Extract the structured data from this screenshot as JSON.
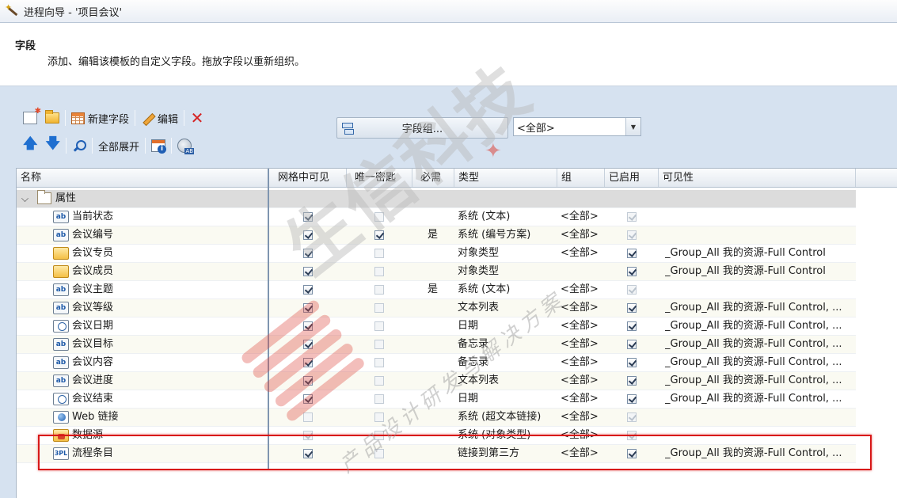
{
  "window": {
    "title": "进程向导 - '项目会议'"
  },
  "header": {
    "heading": "字段",
    "description": "添加、编辑该模板的自定义字段。拖放字段以重新组织。"
  },
  "toolbar": {
    "new_field_label": "新建字段",
    "edit_label": "编辑",
    "expand_all_label": "全部展开",
    "field_group_label": "字段组...",
    "group_filter_value": "<全部>"
  },
  "columns": {
    "name": "名称",
    "visible_in_grid": "网格中可见",
    "unique_key": "唯一密匙",
    "required": "必需",
    "type": "类型",
    "group": "组",
    "enabled": "已启用",
    "visibility": "可见性"
  },
  "group_row": {
    "label": "属性"
  },
  "rows": [
    {
      "icon": "text-field-icon",
      "name": "当前状态",
      "visible": true,
      "visible_disabled": false,
      "unique": false,
      "unique_disabled": true,
      "required": "",
      "type": "系统 (文本)",
      "group": "<全部>",
      "enabled": true,
      "enabled_disabled": true,
      "visibility": ""
    },
    {
      "icon": "text-field-icon",
      "name": "会议编号",
      "visible": true,
      "visible_disabled": false,
      "unique": true,
      "unique_disabled": false,
      "required": "是",
      "type": "系统 (编号方案)",
      "group": "<全部>",
      "enabled": true,
      "enabled_disabled": true,
      "visibility": ""
    },
    {
      "icon": "folder-field-icon",
      "name": "会议专员",
      "visible": true,
      "visible_disabled": false,
      "unique": false,
      "unique_disabled": true,
      "required": "",
      "type": "对象类型",
      "group": "<全部>",
      "enabled": true,
      "enabled_disabled": false,
      "visibility": "_Group_All 我的资源-Full Control"
    },
    {
      "icon": "folder-field-icon",
      "name": "会议成员",
      "visible": true,
      "visible_disabled": false,
      "unique": false,
      "unique_disabled": true,
      "required": "",
      "type": "对象类型",
      "group": "",
      "enabled": true,
      "enabled_disabled": false,
      "visibility": "_Group_All 我的资源-Full Control"
    },
    {
      "icon": "text-field-icon",
      "name": "会议主题",
      "visible": true,
      "visible_disabled": false,
      "unique": false,
      "unique_disabled": true,
      "required": "是",
      "type": "系统 (文本)",
      "group": "<全部>",
      "enabled": true,
      "enabled_disabled": true,
      "visibility": ""
    },
    {
      "icon": "text-field-icon",
      "name": "会议等级",
      "visible": true,
      "visible_disabled": false,
      "unique": false,
      "unique_disabled": true,
      "required": "",
      "type": "文本列表",
      "group": "<全部>",
      "enabled": true,
      "enabled_disabled": false,
      "visibility": "_Group_All 我的资源-Full Control, ..."
    },
    {
      "icon": "clock-field-icon",
      "name": "会议日期",
      "visible": true,
      "visible_disabled": false,
      "unique": false,
      "unique_disabled": true,
      "required": "",
      "type": "日期",
      "group": "<全部>",
      "enabled": true,
      "enabled_disabled": false,
      "visibility": "_Group_All 我的资源-Full Control, ..."
    },
    {
      "icon": "text-field-icon",
      "name": "会议目标",
      "visible": true,
      "visible_disabled": false,
      "unique": false,
      "unique_disabled": true,
      "required": "",
      "type": "备忘录",
      "group": "<全部>",
      "enabled": true,
      "enabled_disabled": false,
      "visibility": "_Group_All 我的资源-Full Control, ..."
    },
    {
      "icon": "text-field-icon",
      "name": "会议内容",
      "visible": true,
      "visible_disabled": false,
      "unique": false,
      "unique_disabled": true,
      "required": "",
      "type": "备忘录",
      "group": "<全部>",
      "enabled": true,
      "enabled_disabled": false,
      "visibility": "_Group_All 我的资源-Full Control, ..."
    },
    {
      "icon": "text-field-icon",
      "name": "会议进度",
      "visible": true,
      "visible_disabled": false,
      "unique": false,
      "unique_disabled": true,
      "required": "",
      "type": "文本列表",
      "group": "<全部>",
      "enabled": true,
      "enabled_disabled": false,
      "visibility": "_Group_All 我的资源-Full Control, ..."
    },
    {
      "icon": "clock-field-icon",
      "name": "会议结束",
      "visible": true,
      "visible_disabled": false,
      "unique": false,
      "unique_disabled": true,
      "required": "",
      "type": "日期",
      "group": "<全部>",
      "enabled": true,
      "enabled_disabled": false,
      "visibility": "_Group_All 我的资源-Full Control, ..."
    },
    {
      "icon": "web-link-icon",
      "name": "Web 链接",
      "visible": false,
      "visible_disabled": true,
      "unique": false,
      "unique_disabled": true,
      "required": "",
      "type": "系统 (超文本链接)",
      "group": "<全部>",
      "enabled": true,
      "enabled_disabled": true,
      "visibility": ""
    },
    {
      "icon": "data-source-icon",
      "name": "数据源",
      "visible": true,
      "visible_disabled": true,
      "unique": false,
      "unique_disabled": true,
      "required": "",
      "type": "系统 (对象类型)",
      "group": "<全部>",
      "enabled": true,
      "enabled_disabled": true,
      "visibility": ""
    },
    {
      "icon": "third-party-icon",
      "name": "流程条目",
      "visible": true,
      "visible_disabled": false,
      "unique": false,
      "unique_disabled": true,
      "required": "",
      "type": "链接到第三方",
      "group": "<全部>",
      "enabled": true,
      "enabled_disabled": false,
      "visibility": "_Group_All 我的资源-Full Control, ..."
    }
  ],
  "icon_text": {
    "text": "ab",
    "third_party": "3PL"
  },
  "watermark": {
    "main": "生信科技",
    "sub": "产品设计研发与解决方案"
  },
  "colors": {
    "highlight": "#d81818",
    "toolbar_bg": "#d6e2f0",
    "group_row_bg": "#dcdcdc"
  }
}
